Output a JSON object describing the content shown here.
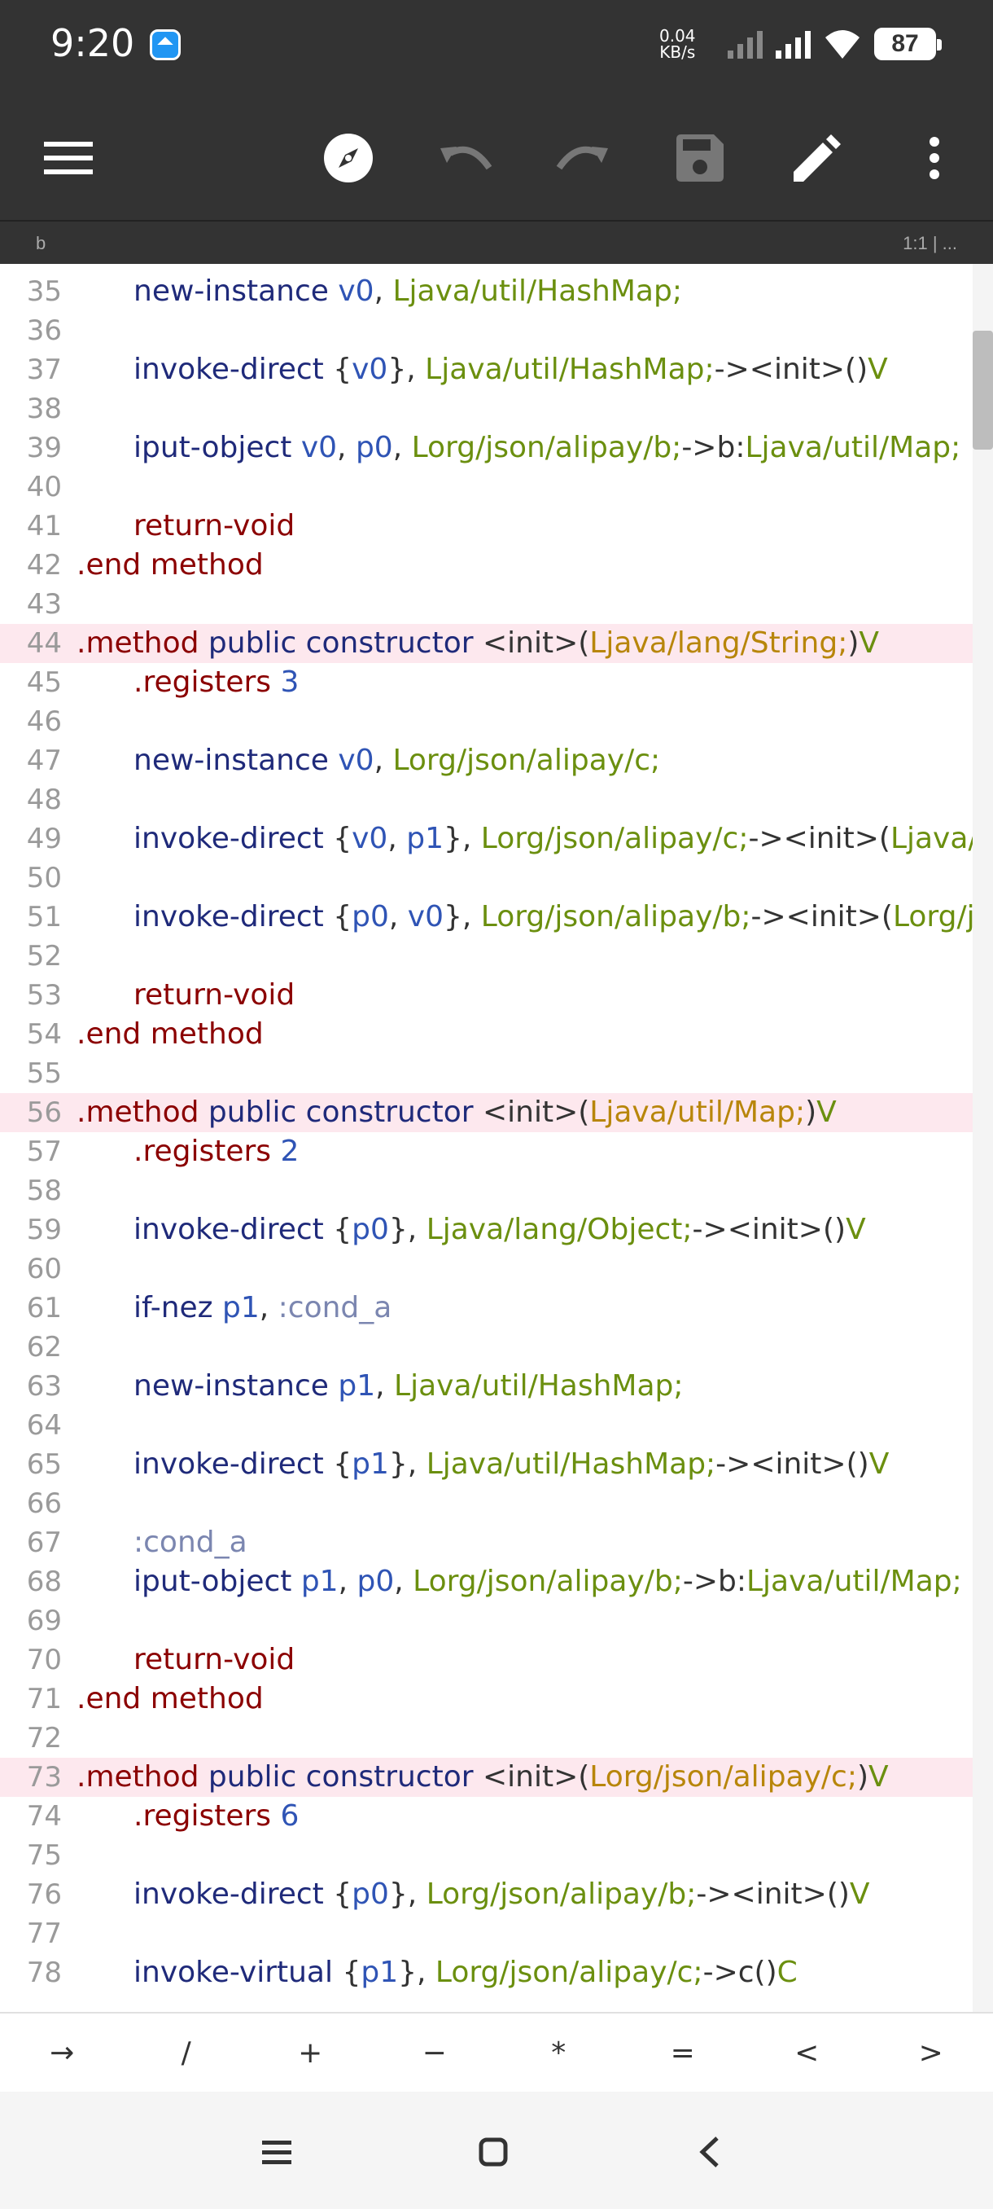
{
  "status_bar": {
    "time": "9:20",
    "net_speed_value": "0.04",
    "net_speed_unit": "KB/s",
    "battery": "87"
  },
  "toolbar": {
    "icons": [
      "menu-icon",
      "compass-icon",
      "undo-icon",
      "redo-icon",
      "save-icon",
      "edit-icon",
      "more-vert-icon"
    ]
  },
  "tabbar": {
    "tab_name": "b",
    "cursor": "1:1  |  ..."
  },
  "editor": {
    "lines": [
      {
        "n": "35",
        "i": 1,
        "t": [
          [
            "new-instance ",
            "kw"
          ],
          [
            "v0",
            "reg"
          ],
          [
            ", ",
            "tx"
          ],
          [
            "Ljava/util/HashMap;",
            "type"
          ]
        ]
      },
      {
        "n": "36",
        "i": 1,
        "t": []
      },
      {
        "n": "37",
        "i": 1,
        "t": [
          [
            "invoke-direct ",
            "kw"
          ],
          [
            "{",
            "tx"
          ],
          [
            "v0",
            "reg"
          ],
          [
            "}, ",
            "tx"
          ],
          [
            "Ljava/util/HashMap;",
            "type"
          ],
          [
            "-><init>()",
            "tx"
          ],
          [
            "V",
            "type"
          ]
        ]
      },
      {
        "n": "38",
        "i": 1,
        "t": []
      },
      {
        "n": "39",
        "i": 1,
        "t": [
          [
            "iput-object ",
            "kw"
          ],
          [
            "v0",
            "reg"
          ],
          [
            ", ",
            "tx"
          ],
          [
            "p0",
            "reg"
          ],
          [
            ", ",
            "tx"
          ],
          [
            "Lorg/json/alipay/b;",
            "type"
          ],
          [
            "->b:",
            "tx"
          ],
          [
            "Ljava/util/Map;",
            "type"
          ]
        ]
      },
      {
        "n": "40",
        "i": 1,
        "t": []
      },
      {
        "n": "41",
        "i": 1,
        "t": [
          [
            "return-void",
            "dir"
          ]
        ]
      },
      {
        "n": "42",
        "i": 0,
        "t": [
          [
            ".end method",
            "dir"
          ]
        ]
      },
      {
        "n": "43",
        "i": 0,
        "t": []
      },
      {
        "n": "44",
        "i": 0,
        "h": true,
        "t": [
          [
            ".method ",
            "dir"
          ],
          [
            "public constructor ",
            "kw"
          ],
          [
            "<init>(",
            "tx"
          ],
          [
            "Ljava/lang/String;",
            "str"
          ],
          [
            ")",
            "tx"
          ],
          [
            "V",
            "type"
          ]
        ]
      },
      {
        "n": "45",
        "i": 1,
        "t": [
          [
            ".registers ",
            "dir"
          ],
          [
            "3",
            "reg"
          ]
        ]
      },
      {
        "n": "46",
        "i": 1,
        "t": []
      },
      {
        "n": "47",
        "i": 1,
        "t": [
          [
            "new-instance ",
            "kw"
          ],
          [
            "v0",
            "reg"
          ],
          [
            ", ",
            "tx"
          ],
          [
            "Lorg/json/alipay/c;",
            "type"
          ]
        ]
      },
      {
        "n": "48",
        "i": 1,
        "t": []
      },
      {
        "n": "49",
        "i": 1,
        "t": [
          [
            "invoke-direct ",
            "kw"
          ],
          [
            "{",
            "tx"
          ],
          [
            "v0",
            "reg"
          ],
          [
            ", ",
            "tx"
          ],
          [
            "p1",
            "reg"
          ],
          [
            "}, ",
            "tx"
          ],
          [
            "Lorg/json/alipay/c;",
            "type"
          ],
          [
            "-><init>(",
            "tx"
          ],
          [
            "Ljava/lang/S",
            "type"
          ]
        ]
      },
      {
        "n": "50",
        "i": 1,
        "t": []
      },
      {
        "n": "51",
        "i": 1,
        "t": [
          [
            "invoke-direct ",
            "kw"
          ],
          [
            "{",
            "tx"
          ],
          [
            "p0",
            "reg"
          ],
          [
            ", ",
            "tx"
          ],
          [
            "v0",
            "reg"
          ],
          [
            "}, ",
            "tx"
          ],
          [
            "Lorg/json/alipay/b;",
            "type"
          ],
          [
            "-><init>(",
            "tx"
          ],
          [
            "Lorg/json/a",
            "type"
          ]
        ]
      },
      {
        "n": "52",
        "i": 1,
        "t": []
      },
      {
        "n": "53",
        "i": 1,
        "t": [
          [
            "return-void",
            "dir"
          ]
        ]
      },
      {
        "n": "54",
        "i": 0,
        "t": [
          [
            ".end method",
            "dir"
          ]
        ]
      },
      {
        "n": "55",
        "i": 0,
        "t": []
      },
      {
        "n": "56",
        "i": 0,
        "h": true,
        "t": [
          [
            ".method ",
            "dir"
          ],
          [
            "public constructor ",
            "kw"
          ],
          [
            "<init>(",
            "tx"
          ],
          [
            "Ljava/util/Map;",
            "str"
          ],
          [
            ")",
            "tx"
          ],
          [
            "V",
            "type"
          ]
        ]
      },
      {
        "n": "57",
        "i": 1,
        "t": [
          [
            ".registers ",
            "dir"
          ],
          [
            "2",
            "reg"
          ]
        ]
      },
      {
        "n": "58",
        "i": 1,
        "t": []
      },
      {
        "n": "59",
        "i": 1,
        "t": [
          [
            "invoke-direct ",
            "kw"
          ],
          [
            "{",
            "tx"
          ],
          [
            "p0",
            "reg"
          ],
          [
            "}, ",
            "tx"
          ],
          [
            "Ljava/lang/Object;",
            "type"
          ],
          [
            "-><init>()",
            "tx"
          ],
          [
            "V",
            "type"
          ]
        ]
      },
      {
        "n": "60",
        "i": 1,
        "t": []
      },
      {
        "n": "61",
        "i": 1,
        "t": [
          [
            "if-nez ",
            "kw"
          ],
          [
            "p1",
            "reg"
          ],
          [
            ", ",
            "tx"
          ],
          [
            ":cond_a",
            "lbl"
          ]
        ]
      },
      {
        "n": "62",
        "i": 1,
        "t": []
      },
      {
        "n": "63",
        "i": 1,
        "t": [
          [
            "new-instance ",
            "kw"
          ],
          [
            "p1",
            "reg"
          ],
          [
            ", ",
            "tx"
          ],
          [
            "Ljava/util/HashMap;",
            "type"
          ]
        ]
      },
      {
        "n": "64",
        "i": 1,
        "t": []
      },
      {
        "n": "65",
        "i": 1,
        "t": [
          [
            "invoke-direct ",
            "kw"
          ],
          [
            "{",
            "tx"
          ],
          [
            "p1",
            "reg"
          ],
          [
            "}, ",
            "tx"
          ],
          [
            "Ljava/util/HashMap;",
            "type"
          ],
          [
            "-><init>()",
            "tx"
          ],
          [
            "V",
            "type"
          ]
        ]
      },
      {
        "n": "66",
        "i": 1,
        "t": []
      },
      {
        "n": "67",
        "i": 1,
        "t": [
          [
            ":cond_a",
            "lbl"
          ]
        ]
      },
      {
        "n": "68",
        "i": 1,
        "t": [
          [
            "iput-object ",
            "kw"
          ],
          [
            "p1",
            "reg"
          ],
          [
            ", ",
            "tx"
          ],
          [
            "p0",
            "reg"
          ],
          [
            ", ",
            "tx"
          ],
          [
            "Lorg/json/alipay/b;",
            "type"
          ],
          [
            "->b:",
            "tx"
          ],
          [
            "Ljava/util/Map;",
            "type"
          ]
        ]
      },
      {
        "n": "69",
        "i": 1,
        "t": []
      },
      {
        "n": "70",
        "i": 1,
        "t": [
          [
            "return-void",
            "dir"
          ]
        ]
      },
      {
        "n": "71",
        "i": 0,
        "t": [
          [
            ".end method",
            "dir"
          ]
        ]
      },
      {
        "n": "72",
        "i": 0,
        "t": []
      },
      {
        "n": "73",
        "i": 0,
        "h": true,
        "t": [
          [
            ".method ",
            "dir"
          ],
          [
            "public constructor ",
            "kw"
          ],
          [
            "<init>(",
            "tx"
          ],
          [
            "Lorg/json/alipay/c;",
            "str"
          ],
          [
            ")",
            "tx"
          ],
          [
            "V",
            "type"
          ]
        ]
      },
      {
        "n": "74",
        "i": 1,
        "t": [
          [
            ".registers ",
            "dir"
          ],
          [
            "6",
            "reg"
          ]
        ]
      },
      {
        "n": "75",
        "i": 1,
        "t": []
      },
      {
        "n": "76",
        "i": 1,
        "t": [
          [
            "invoke-direct ",
            "kw"
          ],
          [
            "{",
            "tx"
          ],
          [
            "p0",
            "reg"
          ],
          [
            "}, ",
            "tx"
          ],
          [
            "Lorg/json/alipay/b;",
            "type"
          ],
          [
            "-><init>()",
            "tx"
          ],
          [
            "V",
            "type"
          ]
        ]
      },
      {
        "n": "77",
        "i": 1,
        "t": []
      },
      {
        "n": "78",
        "i": 1,
        "t": [
          [
            "invoke-virtual ",
            "kw"
          ],
          [
            "{",
            "tx"
          ],
          [
            "p1",
            "reg"
          ],
          [
            "}, ",
            "tx"
          ],
          [
            "Lorg/json/alipay/c;",
            "type"
          ],
          [
            "->c()",
            "tx"
          ],
          [
            "C",
            "type"
          ]
        ]
      }
    ]
  },
  "symbol_bar": {
    "keys": [
      "→",
      "/",
      "+",
      "−",
      "*",
      "=",
      "<",
      ">"
    ]
  },
  "nav_bar": {
    "icons": [
      "recents-icon",
      "home-icon",
      "back-icon"
    ]
  },
  "colors": {
    "bar_bg": "#333333",
    "highlight": "#fde8ee",
    "keyword": "#1f2a7a",
    "type": "#6b8f0f",
    "register": "#2f54b5",
    "directive": "#8b0000"
  }
}
